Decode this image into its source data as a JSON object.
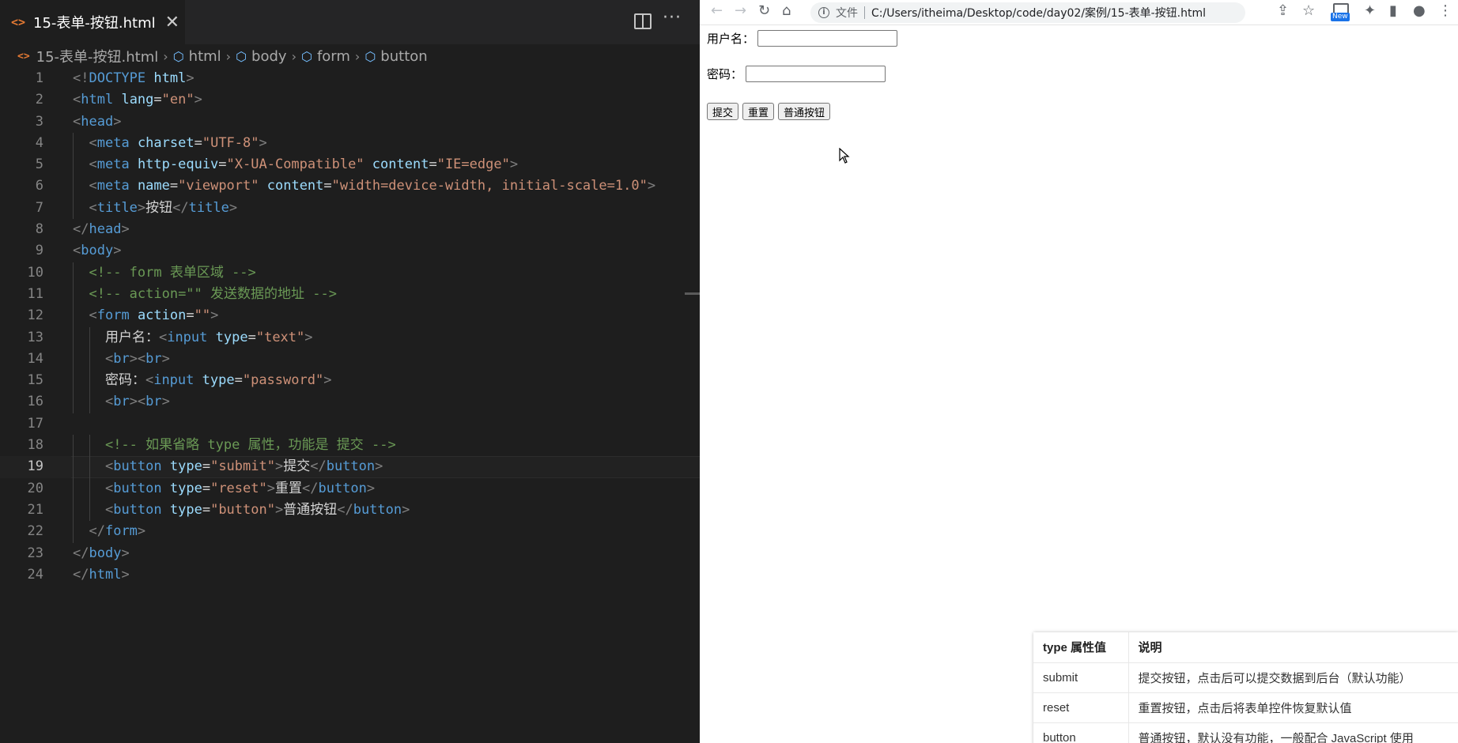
{
  "editor": {
    "tab": {
      "title": "15-表单-按钮.html",
      "file_icon": "<>",
      "close": "✕"
    },
    "actions": {
      "split": "split-editor-icon",
      "more": "···"
    },
    "breadcrumb": [
      "15-表单-按钮.html",
      "html",
      "body",
      "form",
      "button"
    ],
    "current_line": 19,
    "lines": [
      [
        [
          "br",
          "<!"
        ],
        [
          "doc",
          "DOCTYPE"
        ],
        [
          "txt",
          " "
        ],
        [
          "attr",
          "html"
        ],
        [
          "br",
          ">"
        ]
      ],
      [
        [
          "br",
          "<"
        ],
        [
          "tag",
          "html"
        ],
        [
          "txt",
          " "
        ],
        [
          "attr",
          "lang"
        ],
        [
          "txt",
          "="
        ],
        [
          "str",
          "\"en\""
        ],
        [
          "br",
          ">"
        ]
      ],
      [
        [
          "br",
          "<"
        ],
        [
          "tag",
          "head"
        ],
        [
          "br",
          ">"
        ]
      ],
      [
        [
          "txt",
          "  "
        ],
        [
          "br",
          "<"
        ],
        [
          "tag",
          "meta"
        ],
        [
          "txt",
          " "
        ],
        [
          "attr",
          "charset"
        ],
        [
          "txt",
          "="
        ],
        [
          "str",
          "\"UTF-8\""
        ],
        [
          "br",
          ">"
        ]
      ],
      [
        [
          "txt",
          "  "
        ],
        [
          "br",
          "<"
        ],
        [
          "tag",
          "meta"
        ],
        [
          "txt",
          " "
        ],
        [
          "attr",
          "http-equiv"
        ],
        [
          "txt",
          "="
        ],
        [
          "str",
          "\"X-UA-Compatible\""
        ],
        [
          "txt",
          " "
        ],
        [
          "attr",
          "content"
        ],
        [
          "txt",
          "="
        ],
        [
          "str",
          "\"IE=edge\""
        ],
        [
          "br",
          ">"
        ]
      ],
      [
        [
          "txt",
          "  "
        ],
        [
          "br",
          "<"
        ],
        [
          "tag",
          "meta"
        ],
        [
          "txt",
          " "
        ],
        [
          "attr",
          "name"
        ],
        [
          "txt",
          "="
        ],
        [
          "str",
          "\"viewport\""
        ],
        [
          "txt",
          " "
        ],
        [
          "attr",
          "content"
        ],
        [
          "txt",
          "="
        ],
        [
          "str",
          "\"width=device-width, initial-scale=1.0\""
        ],
        [
          "br",
          ">"
        ]
      ],
      [
        [
          "txt",
          "  "
        ],
        [
          "br",
          "<"
        ],
        [
          "tag",
          "title"
        ],
        [
          "br",
          ">"
        ],
        [
          "txt",
          "按钮"
        ],
        [
          "br",
          "</"
        ],
        [
          "tag",
          "title"
        ],
        [
          "br",
          ">"
        ]
      ],
      [
        [
          "br",
          "</"
        ],
        [
          "tag",
          "head"
        ],
        [
          "br",
          ">"
        ]
      ],
      [
        [
          "br",
          "<"
        ],
        [
          "tag",
          "body"
        ],
        [
          "br",
          ">"
        ]
      ],
      [
        [
          "txt",
          "  "
        ],
        [
          "com",
          "<!-- form 表单区域 -->"
        ]
      ],
      [
        [
          "txt",
          "  "
        ],
        [
          "com",
          "<!-- action=\"\" 发送数据的地址 -->"
        ]
      ],
      [
        [
          "txt",
          "  "
        ],
        [
          "br",
          "<"
        ],
        [
          "tag",
          "form"
        ],
        [
          "txt",
          " "
        ],
        [
          "attr",
          "action"
        ],
        [
          "txt",
          "="
        ],
        [
          "str",
          "\"\""
        ],
        [
          "br",
          ">"
        ]
      ],
      [
        [
          "txt",
          "    用户名："
        ],
        [
          "br",
          "<"
        ],
        [
          "tag",
          "input"
        ],
        [
          "txt",
          " "
        ],
        [
          "attr",
          "type"
        ],
        [
          "txt",
          "="
        ],
        [
          "str",
          "\"text\""
        ],
        [
          "br",
          ">"
        ]
      ],
      [
        [
          "txt",
          "    "
        ],
        [
          "br",
          "<"
        ],
        [
          "tag",
          "br"
        ],
        [
          "br",
          "><"
        ],
        [
          "tag",
          "br"
        ],
        [
          "br",
          ">"
        ]
      ],
      [
        [
          "txt",
          "    密码："
        ],
        [
          "br",
          "<"
        ],
        [
          "tag",
          "input"
        ],
        [
          "txt",
          " "
        ],
        [
          "attr",
          "type"
        ],
        [
          "txt",
          "="
        ],
        [
          "str",
          "\"password\""
        ],
        [
          "br",
          ">"
        ]
      ],
      [
        [
          "txt",
          "    "
        ],
        [
          "br",
          "<"
        ],
        [
          "tag",
          "br"
        ],
        [
          "br",
          "><"
        ],
        [
          "tag",
          "br"
        ],
        [
          "br",
          ">"
        ]
      ],
      [],
      [
        [
          "txt",
          "    "
        ],
        [
          "com",
          "<!-- 如果省略 type 属性，功能是 提交 -->"
        ]
      ],
      [
        [
          "txt",
          "    "
        ],
        [
          "br",
          "<"
        ],
        [
          "tag",
          "button"
        ],
        [
          "txt",
          " "
        ],
        [
          "attr",
          "type"
        ],
        [
          "txt",
          "="
        ],
        [
          "str",
          "\"submit\""
        ],
        [
          "br",
          ">"
        ],
        [
          "txt",
          "提交"
        ],
        [
          "br",
          "</"
        ],
        [
          "tag",
          "button"
        ],
        [
          "br",
          ">"
        ]
      ],
      [
        [
          "txt",
          "    "
        ],
        [
          "br",
          "<"
        ],
        [
          "tag",
          "button"
        ],
        [
          "txt",
          " "
        ],
        [
          "attr",
          "type"
        ],
        [
          "txt",
          "="
        ],
        [
          "str",
          "\"reset\""
        ],
        [
          "br",
          ">"
        ],
        [
          "txt",
          "重置"
        ],
        [
          "br",
          "</"
        ],
        [
          "tag",
          "button"
        ],
        [
          "br",
          ">"
        ]
      ],
      [
        [
          "txt",
          "    "
        ],
        [
          "br",
          "<"
        ],
        [
          "tag",
          "button"
        ],
        [
          "txt",
          " "
        ],
        [
          "attr",
          "type"
        ],
        [
          "txt",
          "="
        ],
        [
          "str",
          "\"button\""
        ],
        [
          "br",
          ">"
        ],
        [
          "txt",
          "普通按钮"
        ],
        [
          "br",
          "</"
        ],
        [
          "tag",
          "button"
        ],
        [
          "br",
          ">"
        ]
      ],
      [
        [
          "txt",
          "  "
        ],
        [
          "br",
          "</"
        ],
        [
          "tag",
          "form"
        ],
        [
          "br",
          ">"
        ]
      ],
      [
        [
          "br",
          "</"
        ],
        [
          "tag",
          "body"
        ],
        [
          "br",
          ">"
        ]
      ],
      [
        [
          "br",
          "</"
        ],
        [
          "tag",
          "html"
        ],
        [
          "br",
          ">"
        ]
      ]
    ]
  },
  "browser": {
    "toolbar": {
      "back": "←",
      "forward": "→",
      "reload": "↻",
      "home": "⌂",
      "info": "i",
      "scheme": "文件",
      "url": "C:/Users/itheima/Desktop/code/day02/案例/15-表单-按钮.html",
      "share": "⇪",
      "bookmark": "☆",
      "new_badge": "New",
      "extensions": "✦",
      "sidebar": "▮",
      "profile": "●",
      "menu": "⋮"
    },
    "form": {
      "username_label": "用户名：",
      "password_label": "密码：",
      "buttons": [
        "提交",
        "重置",
        "普通按钮"
      ]
    },
    "ref_table": {
      "headers": [
        "type 属性值",
        "说明"
      ],
      "rows": [
        [
          "submit",
          "提交按钮，点击后可以提交数据到后台（默认功能）"
        ],
        [
          "reset",
          "重置按钮，点击后将表单控件恢复默认值"
        ],
        [
          "button",
          "普通按钮，默认没有功能，一般配合 JavaScript 使用"
        ]
      ]
    }
  },
  "colors": {
    "editor_bg": "#1e1e1e",
    "tag": "#569cd6",
    "attr": "#9cdcfe",
    "string": "#ce9178",
    "comment": "#6a9955",
    "bracket": "#808080"
  }
}
